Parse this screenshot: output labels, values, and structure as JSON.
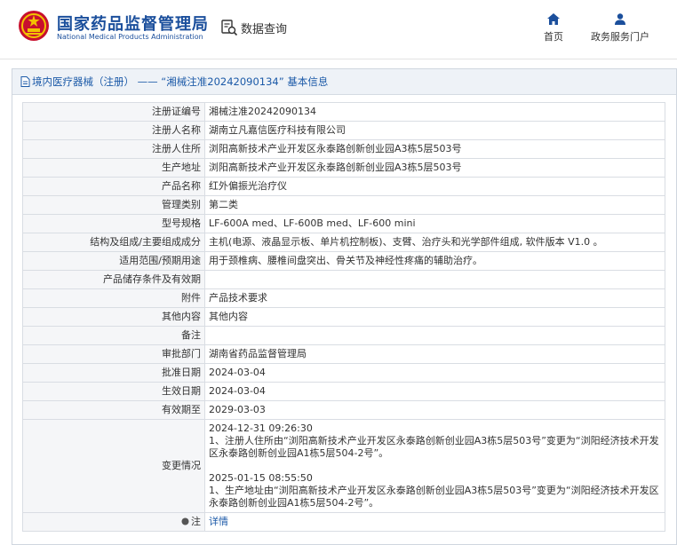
{
  "header": {
    "logo_cn": "国家药品监督管理局",
    "logo_en": "National Medical Products Administration",
    "search_label": "数据查询",
    "nav": {
      "home": "首页",
      "portal": "政务服务门户"
    },
    "accent": "#1b4f9c"
  },
  "panel": {
    "title": "境内医疗器械（注册） —— “湘械注准20242090134” 基本信息"
  },
  "fields": [
    {
      "label": "注册证编号",
      "value": "湘械注准20242090134"
    },
    {
      "label": "注册人名称",
      "value": "湖南立凡嘉信医疗科技有限公司"
    },
    {
      "label": "注册人住所",
      "value": "浏阳高新技术产业开发区永泰路创新创业园A3栋5层503号"
    },
    {
      "label": "生产地址",
      "value": "浏阳高新技术产业开发区永泰路创新创业园A3栋5层503号"
    },
    {
      "label": "产品名称",
      "value": "红外偏振光治疗仪"
    },
    {
      "label": "管理类别",
      "value": "第二类"
    },
    {
      "label": "型号规格",
      "value": "LF-600A med、LF-600B med、LF-600 mini"
    },
    {
      "label": "结构及组成/主要组成成分",
      "value": "主机(电源、液晶显示板、单片机控制板)、支臂、治疗头和光学部件组成, 软件版本 V1.0 。"
    },
    {
      "label": "适用范围/预期用途",
      "value": "用于颈椎病、腰椎间盘突出、骨关节及神经性疼痛的辅助治疗。"
    },
    {
      "label": "产品储存条件及有效期",
      "value": ""
    },
    {
      "label": "附件",
      "value": "产品技术要求"
    },
    {
      "label": "其他内容",
      "value": "其他内容"
    },
    {
      "label": "备注",
      "value": ""
    },
    {
      "label": "审批部门",
      "value": "湖南省药品监督管理局"
    },
    {
      "label": "批准日期",
      "value": "2024-03-04"
    },
    {
      "label": "生效日期",
      "value": "2024-03-04"
    },
    {
      "label": "有效期至",
      "value": "2029-03-03"
    }
  ],
  "change": {
    "label": "变更情况",
    "entries": [
      {
        "time": "2024-12-31 09:26:30",
        "text": "1、注册人住所由“浏阳高新技术产业开发区永泰路创新创业园A3栋5层503号”变更为“浏阳经济技术开发区永泰路创新创业园A1栋5层504-2号”。"
      },
      {
        "time": "2025-01-15 08:55:50",
        "text": "1、生产地址由“浏阳高新技术产业开发区永泰路创新创业园A3栋5层503号”变更为“浏阳经济技术开发区永泰路创新创业园A1栋5层504-2号”。"
      }
    ]
  },
  "note": {
    "label": "注",
    "icon": "info-bullet-icon",
    "link": "详情"
  }
}
